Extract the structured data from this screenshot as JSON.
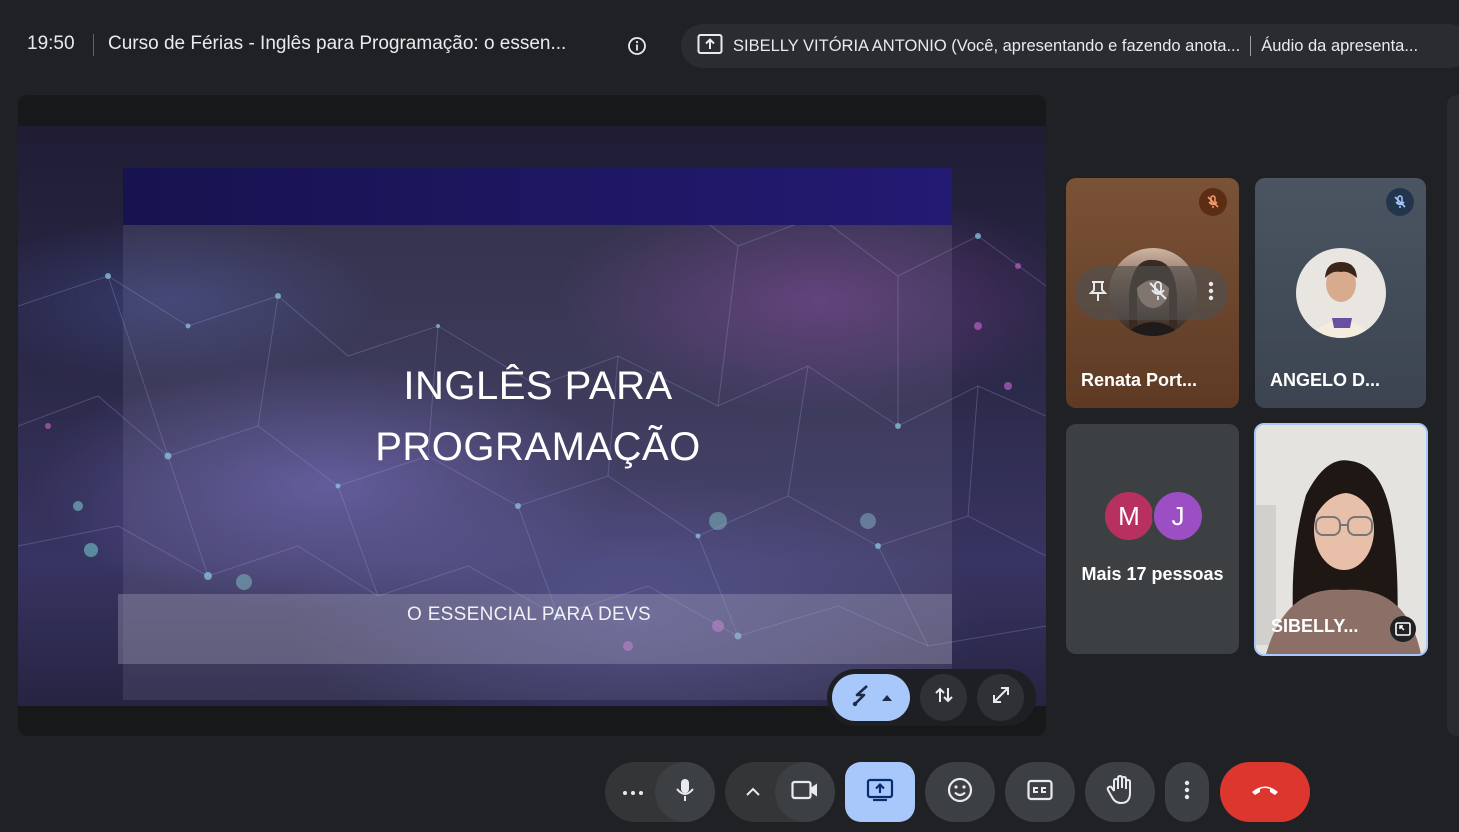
{
  "topbar": {
    "time": "19:50",
    "meeting_title": "Curso de Férias - Inglês para Programação: o essen...",
    "presenting_text": "SIBELLY VITÓRIA ANTONIO (Você, apresentando e fazendo anota...",
    "audio_text": "Áudio da apresenta..."
  },
  "slide": {
    "title": "INGLÊS PARA PROGRAMAÇÃO",
    "subtitle": "O ESSENCIAL PARA DEVS"
  },
  "participants": [
    {
      "name": "Renata Port...",
      "muted": true
    },
    {
      "name": "ANGELO D...",
      "muted": true
    },
    {
      "name": "SIBELLY...",
      "self": true
    }
  ],
  "more": {
    "initials": [
      "M",
      "J"
    ],
    "label": "Mais 17 pessoas",
    "colors": [
      "#b8305f",
      "#9c4fc4"
    ]
  },
  "colors": {
    "accent": "#a8c7fa",
    "end_call": "#dc362e",
    "background": "#202124"
  },
  "icons": {
    "info": "info-icon",
    "present": "present-to-all-icon",
    "annotate": "pen-icon",
    "swap": "swap-icon",
    "fullscreen": "expand-icon",
    "mic": "mic-icon",
    "camera": "camera-icon",
    "emoji": "emoji-icon",
    "captions": "captions-icon",
    "hand": "raise-hand-icon",
    "more": "more-vert-icon",
    "end": "end-call-icon"
  }
}
